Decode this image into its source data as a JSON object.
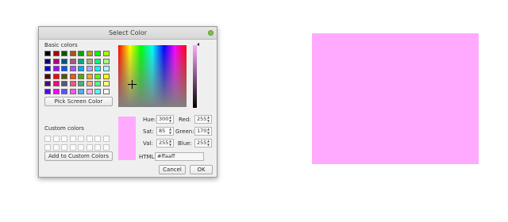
{
  "dialog": {
    "title": "Select Color",
    "basic_colors_label": "Basic colors",
    "custom_colors_label": "Custom colors",
    "pick_screen_color_label": "Pick Screen Color",
    "add_custom_label": "Add to Custom Colors",
    "cancel_label": "Cancel",
    "ok_label": "OK",
    "basic_colors": [
      "#000000",
      "#aa0000",
      "#005500",
      "#aa5500",
      "#00aa00",
      "#aaaa00",
      "#00ff00",
      "#aaff00",
      "#00007f",
      "#aa007f",
      "#00557f",
      "#aa557f",
      "#00aa7f",
      "#aaaa7f",
      "#00ff7f",
      "#aaff7f",
      "#0000ff",
      "#aa00ff",
      "#0055ff",
      "#aa55ff",
      "#00aaff",
      "#aaaaff",
      "#00ffff",
      "#aaffff",
      "#550000",
      "#ff0000",
      "#555500",
      "#ff5500",
      "#55aa00",
      "#ffaa00",
      "#55ff00",
      "#ffff00",
      "#55007f",
      "#ff007f",
      "#55557f",
      "#ff557f",
      "#55aa7f",
      "#ffaa7f",
      "#55ff7f",
      "#ffff7f",
      "#5500ff",
      "#ff00ff",
      "#5555ff",
      "#ff55ff",
      "#55aaff",
      "#ffaaff",
      "#55ffff",
      "#ffffff"
    ],
    "fields": {
      "hue_label": "Hue:",
      "hue_value": "300",
      "sat_label": "Sat:",
      "sat_value": "85",
      "val_label": "Val:",
      "val_value": "255",
      "red_label": "Red:",
      "red_value": "255",
      "green_label": "Green:",
      "green_value": "170",
      "blue_label": "Blue:",
      "blue_value": "255",
      "html_label": "HTML:",
      "html_value": "#ffaaff"
    },
    "selected_color": "#ffaaff"
  }
}
